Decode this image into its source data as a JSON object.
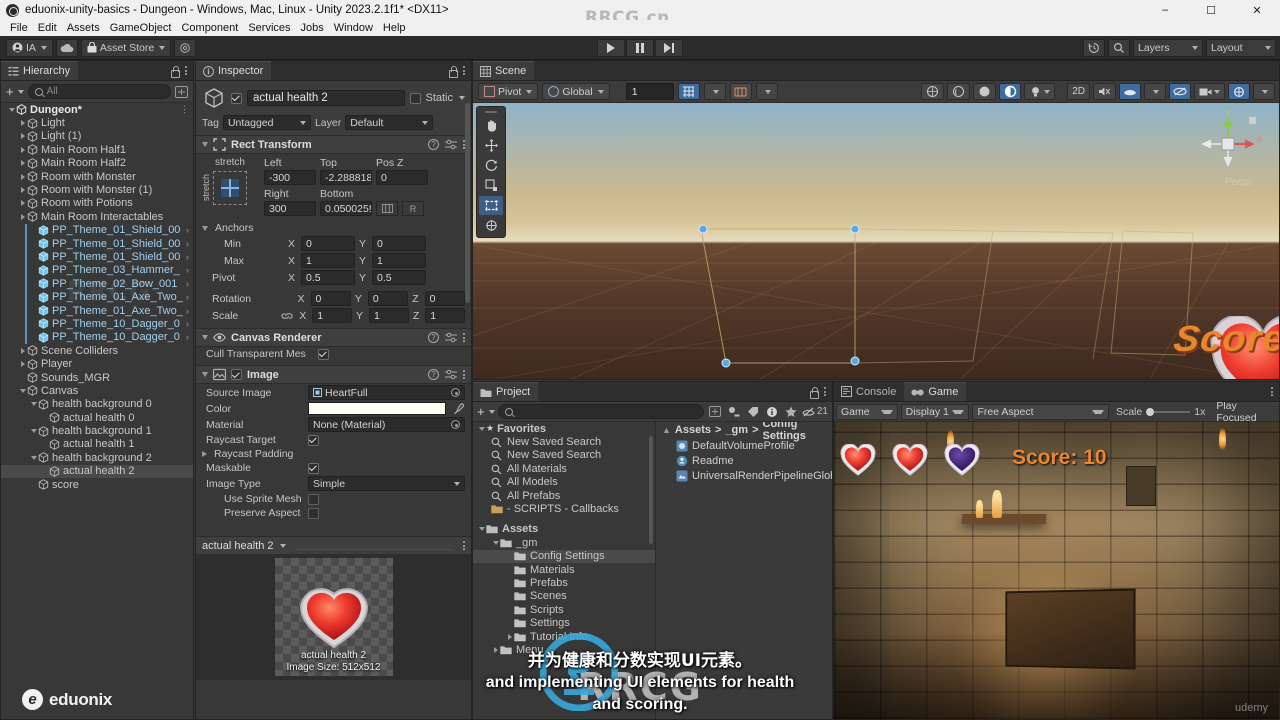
{
  "window": {
    "title": "eduonix-unity-basics - Dungeon - Windows, Mac, Linux - Unity 2023.2.1f1* <DX11>",
    "icon": "unity-icon",
    "buttons": {
      "minimize": "–",
      "maximize": "☐",
      "close": "✕"
    }
  },
  "menubar": {
    "items": [
      "File",
      "Edit",
      "Assets",
      "GameObject",
      "Component",
      "Services",
      "Jobs",
      "Window",
      "Help"
    ]
  },
  "toolbar": {
    "account_label": "IA",
    "cloud_icon": "cloud-icon",
    "asset_store_label": "Asset Store",
    "settings_icon": "gear-icon",
    "play_icon": "play-icon",
    "pause_icon": "pause-icon",
    "step_icon": "step-icon",
    "history_icon": "history-icon",
    "search_icon": "search-icon",
    "layers_label": "Layers",
    "layout_label": "Layout"
  },
  "hierarchy": {
    "tab": "Hierarchy",
    "add_label": "+",
    "search_placeholder": "All",
    "items": [
      {
        "label": "Dungeon*",
        "depth": 0,
        "arrow": "down",
        "icon": "unity-scene-icon",
        "style": "root",
        "kebab": true
      },
      {
        "label": "Light",
        "depth": 1,
        "arrow": "right",
        "icon": "gameobject-icon"
      },
      {
        "label": "Light (1)",
        "depth": 1,
        "arrow": "right",
        "icon": "gameobject-icon"
      },
      {
        "label": "Main Room Half1",
        "depth": 1,
        "arrow": "right",
        "icon": "gameobject-icon"
      },
      {
        "label": "Main Room Half2",
        "depth": 1,
        "arrow": "right",
        "icon": "gameobject-icon"
      },
      {
        "label": "Room with Monster",
        "depth": 1,
        "arrow": "right",
        "icon": "gameobject-icon"
      },
      {
        "label": "Room with Monster (1)",
        "depth": 1,
        "arrow": "right",
        "icon": "gameobject-icon"
      },
      {
        "label": "Room with Potions",
        "depth": 1,
        "arrow": "right",
        "icon": "gameobject-icon"
      },
      {
        "label": "Main Room Interactables",
        "depth": 1,
        "arrow": "right",
        "icon": "gameobject-icon"
      },
      {
        "label": "PP_Theme_01_Shield_00",
        "depth": 2,
        "arrow": "none",
        "icon": "prefab-icon",
        "style": "prefab",
        "chevron": ">"
      },
      {
        "label": "PP_Theme_01_Shield_00",
        "depth": 2,
        "arrow": "none",
        "icon": "prefab-icon",
        "style": "prefab",
        "chevron": ">"
      },
      {
        "label": "PP_Theme_01_Shield_00",
        "depth": 2,
        "arrow": "none",
        "icon": "prefab-icon",
        "style": "prefab",
        "chevron": ">"
      },
      {
        "label": "PP_Theme_03_Hammer_",
        "depth": 2,
        "arrow": "none",
        "icon": "prefab-icon",
        "style": "prefab",
        "chevron": ">"
      },
      {
        "label": "PP_Theme_02_Bow_001",
        "depth": 2,
        "arrow": "none",
        "icon": "prefab-icon",
        "style": "prefab",
        "chevron": ">"
      },
      {
        "label": "PP_Theme_01_Axe_Two_",
        "depth": 2,
        "arrow": "none",
        "icon": "prefab-icon",
        "style": "prefab",
        "chevron": ">"
      },
      {
        "label": "PP_Theme_01_Axe_Two_",
        "depth": 2,
        "arrow": "none",
        "icon": "prefab-icon",
        "style": "prefab",
        "chevron": ">"
      },
      {
        "label": "PP_Theme_10_Dagger_0",
        "depth": 2,
        "arrow": "none",
        "icon": "prefab-icon",
        "style": "prefab",
        "chevron": ">"
      },
      {
        "label": "PP_Theme_10_Dagger_0",
        "depth": 2,
        "arrow": "none",
        "icon": "prefab-icon",
        "style": "prefab",
        "chevron": ">"
      },
      {
        "label": "Scene Colliders",
        "depth": 1,
        "arrow": "right",
        "icon": "gameobject-icon"
      },
      {
        "label": "Player",
        "depth": 1,
        "arrow": "right",
        "icon": "gameobject-icon"
      },
      {
        "label": "Sounds_MGR",
        "depth": 1,
        "arrow": "none",
        "icon": "gameobject-icon"
      },
      {
        "label": "Canvas",
        "depth": 1,
        "arrow": "down",
        "icon": "gameobject-icon"
      },
      {
        "label": "health background 0",
        "depth": 2,
        "arrow": "down",
        "icon": "gameobject-icon"
      },
      {
        "label": "actual health 0",
        "depth": 3,
        "arrow": "none",
        "icon": "gameobject-icon"
      },
      {
        "label": "health background 1",
        "depth": 2,
        "arrow": "down",
        "icon": "gameobject-icon"
      },
      {
        "label": "actual health 1",
        "depth": 3,
        "arrow": "none",
        "icon": "gameobject-icon"
      },
      {
        "label": "health background 2",
        "depth": 2,
        "arrow": "down",
        "icon": "gameobject-icon"
      },
      {
        "label": "actual health 2",
        "depth": 3,
        "arrow": "none",
        "icon": "gameobject-icon",
        "selected": true
      },
      {
        "label": "score",
        "depth": 2,
        "arrow": "none",
        "icon": "gameobject-icon"
      }
    ]
  },
  "inspector": {
    "tab": "Inspector",
    "object_name": "actual health 2",
    "enabled": true,
    "static_label": "Static",
    "tag_label": "Tag",
    "tag_value": "Untagged",
    "layer_label": "Layer",
    "layer_value": "Default",
    "rect_transform": {
      "title": "Rect Transform",
      "anchor_preset": "stretch",
      "anchor_preset_vertical": "stretch",
      "headers_row1": [
        "Left",
        "Top",
        "Pos Z"
      ],
      "values_row1": [
        "-300",
        "-2.288818",
        "0"
      ],
      "headers_row2": [
        "Right",
        "Bottom"
      ],
      "values_row2": [
        "300",
        "0.050025!"
      ],
      "blueprint_btn": "blueprint-mode-icon",
      "raw_btn": "R",
      "anchors_label": "Anchors",
      "min_label": "Min",
      "min_x": "0",
      "min_y": "0",
      "max_label": "Max",
      "max_x": "1",
      "max_y": "1",
      "pivot_label": "Pivot",
      "pivot_x": "0.5",
      "pivot_y": "0.5",
      "rotation_label": "Rotation",
      "rot_x": "0",
      "rot_y": "0",
      "rot_z": "0",
      "scale_label": "Scale",
      "scale_x": "1",
      "scale_y": "1",
      "scale_z": "1",
      "axis_x": "X",
      "axis_y": "Y",
      "axis_z": "Z"
    },
    "canvas_renderer": {
      "title": "Canvas Renderer",
      "cull_label": "Cull Transparent Mes",
      "cull_checked": true
    },
    "image": {
      "title": "Image",
      "enabled": true,
      "source_image_label": "Source Image",
      "source_image_value": "HeartFull",
      "color_label": "Color",
      "color_value": "#FFFFFF",
      "material_label": "Material",
      "material_value": "None (Material)",
      "raycast_target_label": "Raycast Target",
      "raycast_target_checked": true,
      "raycast_padding_label": "Raycast Padding",
      "maskable_label": "Maskable",
      "maskable_checked": true,
      "image_type_label": "Image Type",
      "image_type_value": "Simple",
      "use_sprite_mesh_label": "Use Sprite Mesh",
      "use_sprite_mesh_checked": false,
      "preserve_aspect_label": "Preserve Aspect",
      "preserve_aspect_checked": false
    },
    "preview": {
      "title": "actual health 2",
      "asset_name": "actual health 2",
      "image_size": "Image Size: 512x512"
    }
  },
  "scene": {
    "tab": "Scene",
    "pivot_label": "Pivot",
    "global_label": "Global",
    "grid_value": "1",
    "grid_snap_icon": "grid-snap-icon",
    "snap_icon": "snap-increment-icon",
    "right_icons": [
      "lighting-icon",
      "audio-icon",
      "fx-icon",
      "shading-mode-icon",
      "2D",
      "gizmos-lighting-icon",
      "visibility-icon",
      "camera-icon",
      "gizmos-icon"
    ],
    "toggle_2d": "2D",
    "tools": [
      "hand-tool",
      "move-tool",
      "rotate-tool",
      "scale-tool",
      "rect-tool",
      "transform-tool"
    ],
    "active_tool": "rect-tool",
    "gizmo_axes": {
      "x": "X",
      "y": "Y"
    },
    "perspective_label": "Persp",
    "score_text": "Score"
  },
  "project": {
    "tab": "Project",
    "search_placeholder": "",
    "badge_count": "21",
    "favorites_label": "Favorites",
    "favorites": [
      {
        "label": "New Saved Search",
        "icon": "search-icon"
      },
      {
        "label": "New Saved Search",
        "icon": "search-icon"
      },
      {
        "label": "All Materials",
        "icon": "search-icon"
      },
      {
        "label": "All Models",
        "icon": "search-icon"
      },
      {
        "label": "All Prefabs",
        "icon": "search-icon"
      },
      {
        "label": "- SCRIPTS - Callbacks",
        "icon": "folder-icon"
      }
    ],
    "assets_label": "Assets",
    "tree": [
      {
        "label": "_gm",
        "depth": 1,
        "arrow": "down",
        "icon": "folder-icon"
      },
      {
        "label": "Config Settings",
        "depth": 2,
        "arrow": "none",
        "icon": "folder-icon",
        "selected": true
      },
      {
        "label": "Materials",
        "depth": 2,
        "arrow": "none",
        "icon": "folder-icon"
      },
      {
        "label": "Prefabs",
        "depth": 2,
        "arrow": "none",
        "icon": "folder-icon"
      },
      {
        "label": "Scenes",
        "depth": 2,
        "arrow": "none",
        "icon": "folder-icon"
      },
      {
        "label": "Scripts",
        "depth": 2,
        "arrow": "none",
        "icon": "folder-icon"
      },
      {
        "label": "Settings",
        "depth": 2,
        "arrow": "none",
        "icon": "folder-icon"
      },
      {
        "label": "Tutorial Info",
        "depth": 2,
        "arrow": "right",
        "icon": "folder-icon"
      },
      {
        "label": "Menu",
        "depth": 1,
        "arrow": "right",
        "icon": "folder-icon"
      }
    ],
    "breadcrumb": [
      "Assets",
      "_gm",
      "Config Settings"
    ],
    "breadcrumb_sep": ">",
    "assets": [
      {
        "label": "DefaultVolumeProfile",
        "icon": "volume-profile-icon"
      },
      {
        "label": "Readme",
        "icon": "readme-icon"
      },
      {
        "label": "UniversalRenderPipelineGlob",
        "icon": "render-pipeline-icon"
      }
    ]
  },
  "game": {
    "tabs": [
      {
        "label": "Console",
        "icon": "console-icon",
        "active": false
      },
      {
        "label": "Game",
        "icon": "game-icon",
        "active": true
      }
    ],
    "display_target": "Game",
    "display": "Display 1",
    "aspect": "Free Aspect",
    "scale_label": "Scale",
    "scale_value": "1x",
    "play_focused": "Play Focused",
    "hud_score": "Score: 10",
    "hearts": [
      "full",
      "full",
      "empty"
    ]
  },
  "overlay": {
    "subtitle_cn": "并为健康和分数实现UI元素。",
    "subtitle_en_line1": "and implementing UI elements for health",
    "subtitle_en_line2": "and scoring.",
    "watermark_top": "RRCG.cn",
    "watermark_mid": "RRCG",
    "brand": "eduonix",
    "brand_mark": "e",
    "platform": "udemy"
  },
  "colors": {
    "accent_blue": "#3f6b9e",
    "score_orange": "#e8872b",
    "heart_red": "#e8413a",
    "heart_empty": "#4a2a78",
    "panel_bg": "#383838",
    "header_bg": "#3c3c3c"
  }
}
